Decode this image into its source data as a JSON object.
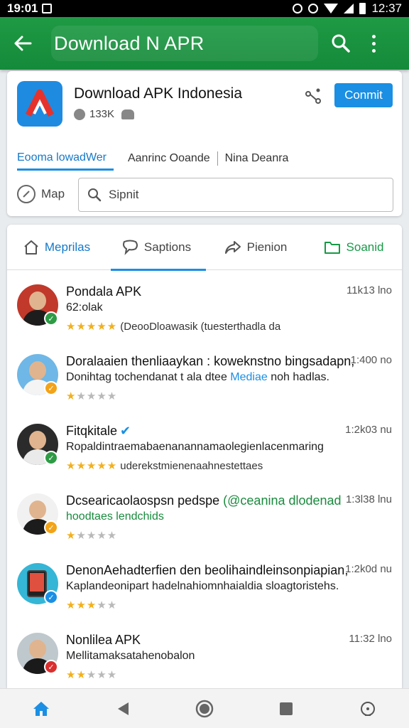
{
  "status_bar": {
    "left_time": "19:01",
    "right_time": "12:37"
  },
  "app_bar": {
    "title": "Download N APR"
  },
  "app_card": {
    "name": "Download APK Indonesia",
    "stat": "133K",
    "connect_label": "Conmit",
    "subtabs": [
      "Eooma lowadWer",
      "Aanrinc Ooande",
      "Nina Deanra"
    ],
    "map_label": "Map",
    "search_placeholder": "Sipnit"
  },
  "tabs": [
    {
      "label": "Meprilas",
      "icon": "home-icon"
    },
    {
      "label": "Saptions",
      "icon": "chat-bubble-icon"
    },
    {
      "label": "Pienion",
      "icon": "share-icon"
    },
    {
      "label": "Soanid",
      "icon": "folder-icon"
    }
  ],
  "colors": {
    "app_bar": "#1f9a44",
    "accent_blue": "#1a8fe3",
    "star": "#f2b01e",
    "badge_green": "#2e9b45",
    "badge_orange": "#f2a318",
    "badge_red": "#d92f2f",
    "badge_blue": "#1a8fe3"
  },
  "items": [
    {
      "name": "Pondala APK",
      "desc": "62:olak",
      "time": "11k13 lno",
      "rating": 5,
      "star_note": "(DeooDloawasik (tuesterthadla da",
      "badge": "green"
    },
    {
      "name": "Doralaaien thenliaaykan : koweknstno bingsadapn,",
      "desc": "Donihtag tochendanat t ala dtee",
      "desc_accent": "Mediae",
      "desc_tail": "noh hadlas.",
      "time": "1:400 no",
      "rating": 1,
      "badge": "orange"
    },
    {
      "name": "Fitqkitale",
      "verified": true,
      "desc": "Ropaldintraemabaenanannamaolegienlacenmaring",
      "time": "1:2k03 nu",
      "rating": 5,
      "star_note": "uderekstmienenaahnestettaes",
      "badge": "green"
    },
    {
      "name": "Dcsearicaolaospsn pedspe",
      "name_accent": "(@ceanina dlodenad",
      "desc": "hoodtaes lendchids",
      "time": "1:3l38 lnu",
      "rating": 1,
      "badge": "orange"
    },
    {
      "name": "DenonAehadterfien den beolihaindleinsonpiapian,",
      "desc": "Kaplandeonipart hadelnahiomnhaialdia sloagtoristehs.",
      "time": "1:2k0d nu",
      "rating": 3,
      "badge": "blue"
    },
    {
      "name": "Nonlilea APK",
      "desc": "Mellitamaksatahenobalon",
      "time": "11:32 lno",
      "rating": 2,
      "badge": "red"
    }
  ],
  "nav": [
    "home-icon",
    "back-icon",
    "home-circle-icon",
    "recents-icon",
    "info-icon"
  ]
}
